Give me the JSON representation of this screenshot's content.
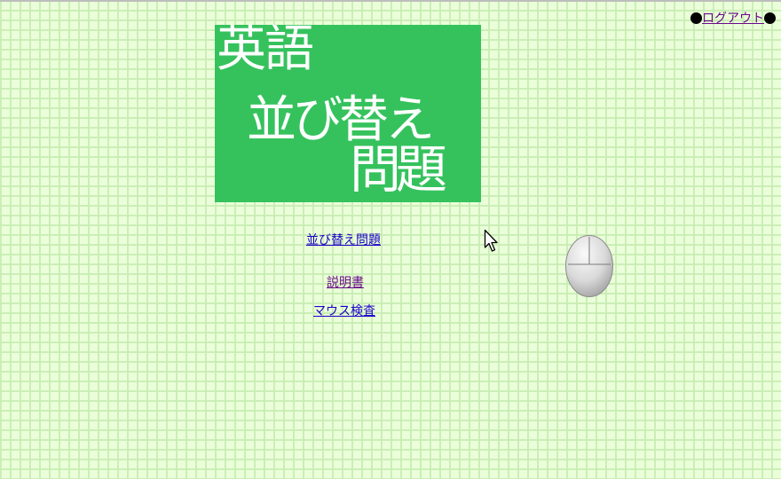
{
  "header": {
    "logout_label": "ログアウト"
  },
  "banner": {
    "line1": "英語",
    "line2": "並び替え",
    "line3": "問題"
  },
  "menu": {
    "item1": "並び替え問題",
    "item2": "説明書",
    "item3": "マウス検査"
  },
  "colors": {
    "background": "#eaffd9",
    "grid": "#c8ecb4",
    "banner": "#35c25d",
    "link": "#1a00c8",
    "visited_link": "#6b0a8a"
  },
  "icons": {
    "cursor": "mouse-pointer-icon",
    "mouse": "computer-mouse-icon",
    "bullet": "black-circle-bullet"
  }
}
